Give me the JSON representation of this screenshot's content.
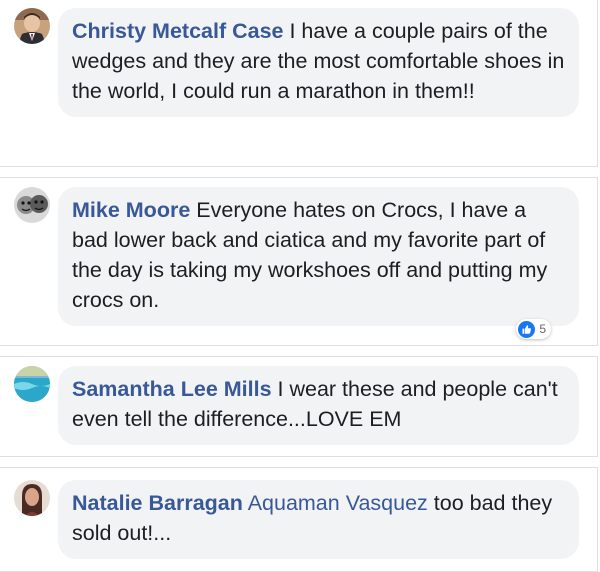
{
  "comments": [
    {
      "name": "Christy Metcalf Case",
      "text": "I have a couple pairs of the wedges and they are the most comfortable shoes in the world, I could run a marathon in them!!",
      "avatar": "man-in-suit-avatar"
    },
    {
      "name": "Mike Moore",
      "text": "Everyone hates on Crocs, I have a bad lower back and ciatica and my favorite part of the day is taking my workshoes off and putting my crocs on.",
      "avatar": "two-faces-avatar",
      "reaction": {
        "icon": "like-icon",
        "count": "5"
      }
    },
    {
      "name": "Samantha Lee Mills",
      "text": "I wear these and people can't even tell the difference...LOVE EM",
      "avatar": "pool-avatar"
    },
    {
      "name": "Natalie Barragan",
      "mention": "Aquaman Vasquez",
      "text": "too bad they sold out!...",
      "avatar": "woman-portrait-avatar"
    }
  ],
  "colors": {
    "name_link": "#385898",
    "bubble_bg": "#f2f3f5",
    "like_blue": "#1877f2"
  }
}
